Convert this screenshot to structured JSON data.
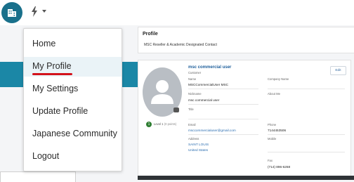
{
  "topbar": {
    "app_icon": "building-icon",
    "bolt_icon": "lightning-bolt-icon",
    "caret_icon": "caret-down-icon"
  },
  "menu": {
    "items": [
      {
        "label": "Home"
      },
      {
        "label": "My Profile"
      },
      {
        "label": "My Settings"
      },
      {
        "label": "Update Profile"
      },
      {
        "label": "Japanese Community"
      },
      {
        "label": "Logout"
      }
    ],
    "active_index": 1
  },
  "profile_header": {
    "title": "Profile",
    "subtitle": "MSC Reseller & Academic Designated Contact"
  },
  "profile": {
    "name": "msc commercial user",
    "role": "Customer",
    "edit_label": "Edit",
    "level_number": "1",
    "level_label": "Level 1",
    "level_points": "(0 points)",
    "fields": {
      "name_label": "Name",
      "name_value": "MSCCommercialUser MSC",
      "company_label": "Company Name",
      "nickname_label": "Nickname",
      "nickname_value": "msc commercial user",
      "about_label": "About Me",
      "title_label": "Title",
      "email_label": "Email",
      "email_value": "msccommercialuser@gmail.com",
      "phone_label": "Phone",
      "phone_value": "7144453506",
      "address_label": "Address",
      "address_city": "SAINT LOUIS",
      "address_country": "United States",
      "mobile_label": "Mobile",
      "fax_label": "Fax",
      "fax_value": "(714) 896-6268"
    }
  },
  "colors": {
    "accent_teal": "#19708b",
    "band_teal": "#1b87a6",
    "underline_red": "#d3121b",
    "link_blue": "#2a6db0"
  }
}
